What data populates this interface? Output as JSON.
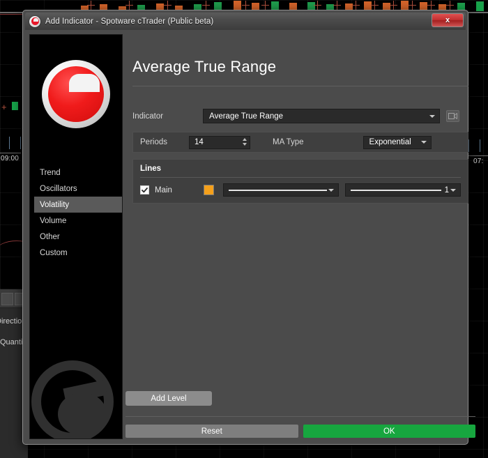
{
  "window": {
    "title": "Add Indicator - Spotware cTrader (Public beta)",
    "close_label": "x",
    "logo_name": "ctrader-logo"
  },
  "sidebar": {
    "items": [
      {
        "label": "Trend",
        "selected": false
      },
      {
        "label": "Oscillators",
        "selected": false
      },
      {
        "label": "Volatility",
        "selected": true
      },
      {
        "label": "Volume",
        "selected": false
      },
      {
        "label": "Other",
        "selected": false
      },
      {
        "label": "Custom",
        "selected": false
      }
    ]
  },
  "main": {
    "page_title": "Average True Range",
    "indicator": {
      "label": "Indicator",
      "value": "Average True Range",
      "video_icon": "video-camera-icon"
    },
    "params": {
      "periods_label": "Periods",
      "periods_value": "14",
      "ma_type_label": "MA Type",
      "ma_type_value": "Exponential"
    },
    "lines": {
      "title": "Lines",
      "rows": [
        {
          "name": "Main",
          "checked": true,
          "color": "#f5a01b",
          "style": "solid",
          "width": "1"
        }
      ]
    },
    "buttons": {
      "add_level": "Add Level",
      "reset": "Reset",
      "ok": "OK"
    }
  },
  "background": {
    "time_label_left": "09:00",
    "time_label_right": "07:",
    "panel_labels": [
      "Direction",
      "Quantity"
    ],
    "colors": {
      "up_candle": "#1f9d4d",
      "down_candle": "#d4642a",
      "accent_green": "#17a63f",
      "accent_red": "#e8182a"
    }
  }
}
